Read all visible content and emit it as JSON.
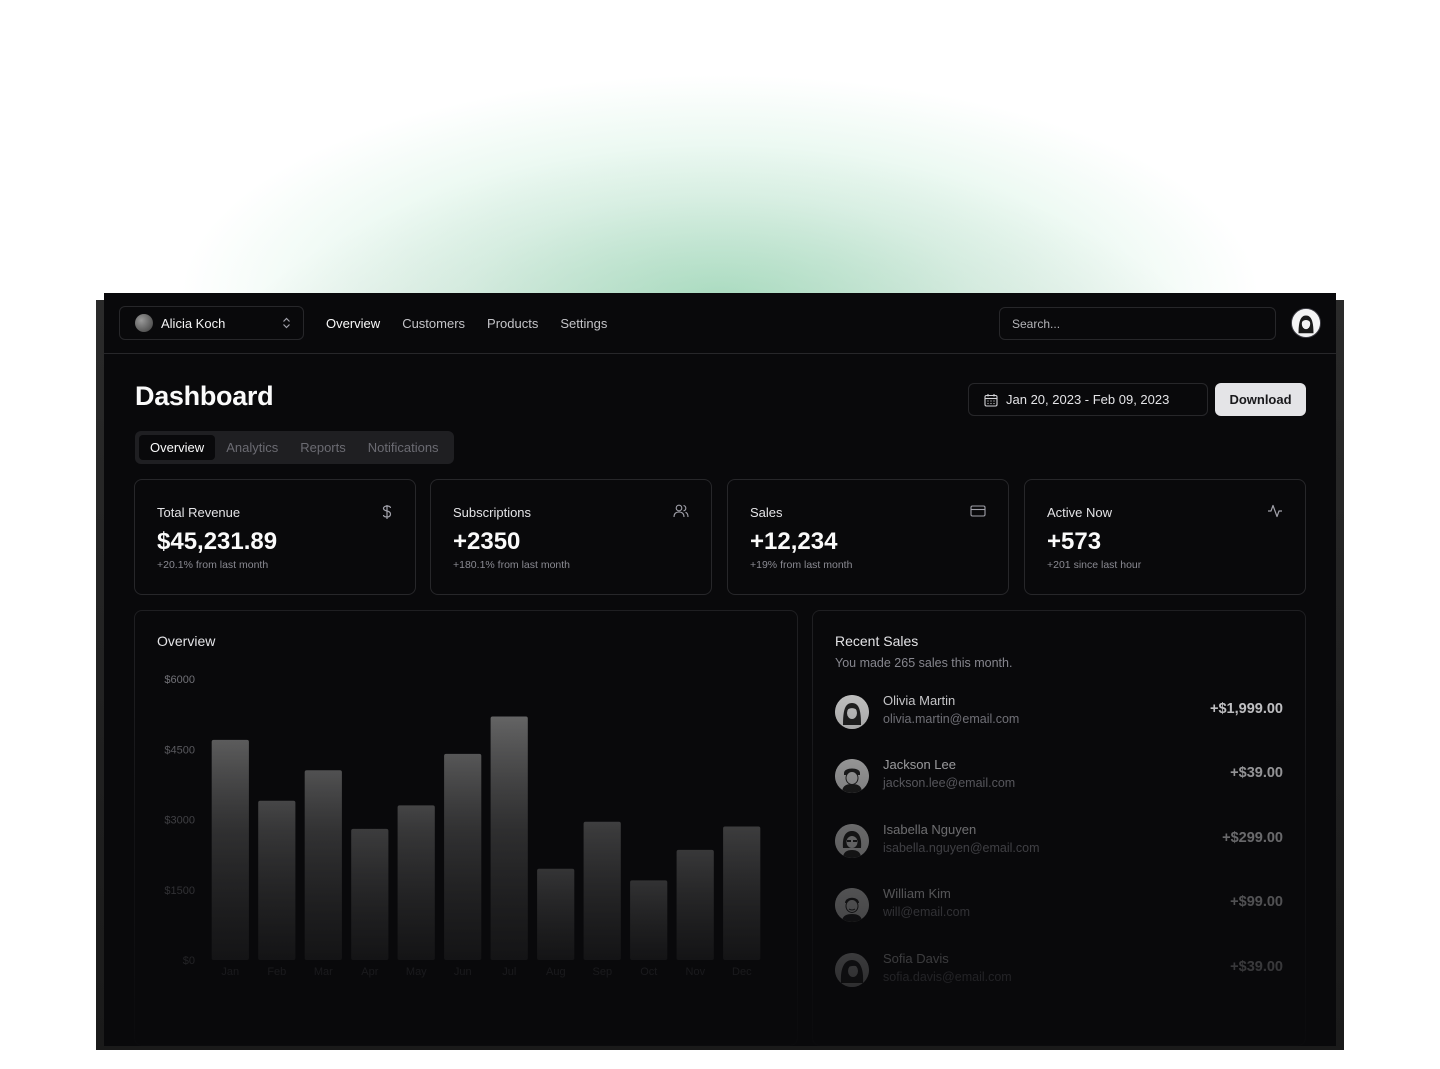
{
  "team_switcher": {
    "name": "Alicia Koch"
  },
  "nav": {
    "items": [
      "Overview",
      "Customers",
      "Products",
      "Settings"
    ]
  },
  "search": {
    "placeholder": "Search..."
  },
  "header": {
    "title": "Dashboard",
    "date_range": "Jan 20, 2023 - Feb 09, 2023",
    "download_label": "Download"
  },
  "tabs": [
    "Overview",
    "Analytics",
    "Reports",
    "Notifications"
  ],
  "stats": [
    {
      "label": "Total Revenue",
      "value": "$45,231.89",
      "sub": "+20.1% from last month",
      "icon": "dollar-icon"
    },
    {
      "label": "Subscriptions",
      "value": "+2350",
      "sub": "+180.1% from last month",
      "icon": "users-icon"
    },
    {
      "label": "Sales",
      "value": "+12,234",
      "sub": "+19% from last month",
      "icon": "credit-card-icon"
    },
    {
      "label": "Active Now",
      "value": "+573",
      "sub": "+201 since last hour",
      "icon": "activity-icon"
    }
  ],
  "overview": {
    "title": "Overview"
  },
  "chart_data": {
    "type": "bar",
    "title": "Overview",
    "categories": [
      "Jan",
      "Feb",
      "Mar",
      "Apr",
      "May",
      "Jun",
      "Jul",
      "Aug",
      "Sep",
      "Oct",
      "Nov",
      "Dec"
    ],
    "values": [
      4700,
      3400,
      4050,
      2800,
      3300,
      4400,
      5200,
      1950,
      2950,
      1700,
      2350,
      2850
    ],
    "yticks": [
      "$0",
      "$1500",
      "$3000",
      "$4500",
      "$6000"
    ],
    "ylim": [
      0,
      6000
    ],
    "bar_color": "#6b6b6b"
  },
  "recent_sales": {
    "title": "Recent Sales",
    "subtitle": "You made 265 sales this month.",
    "items": [
      {
        "name": "Olivia Martin",
        "email": "olivia.martin@email.com",
        "amount": "+$1,999.00"
      },
      {
        "name": "Jackson Lee",
        "email": "jackson.lee@email.com",
        "amount": "+$39.00"
      },
      {
        "name": "Isabella Nguyen",
        "email": "isabella.nguyen@email.com",
        "amount": "+$299.00"
      },
      {
        "name": "William Kim",
        "email": "will@email.com",
        "amount": "+$99.00"
      },
      {
        "name": "Sofia Davis",
        "email": "sofia.davis@email.com",
        "amount": "+$39.00"
      }
    ]
  }
}
